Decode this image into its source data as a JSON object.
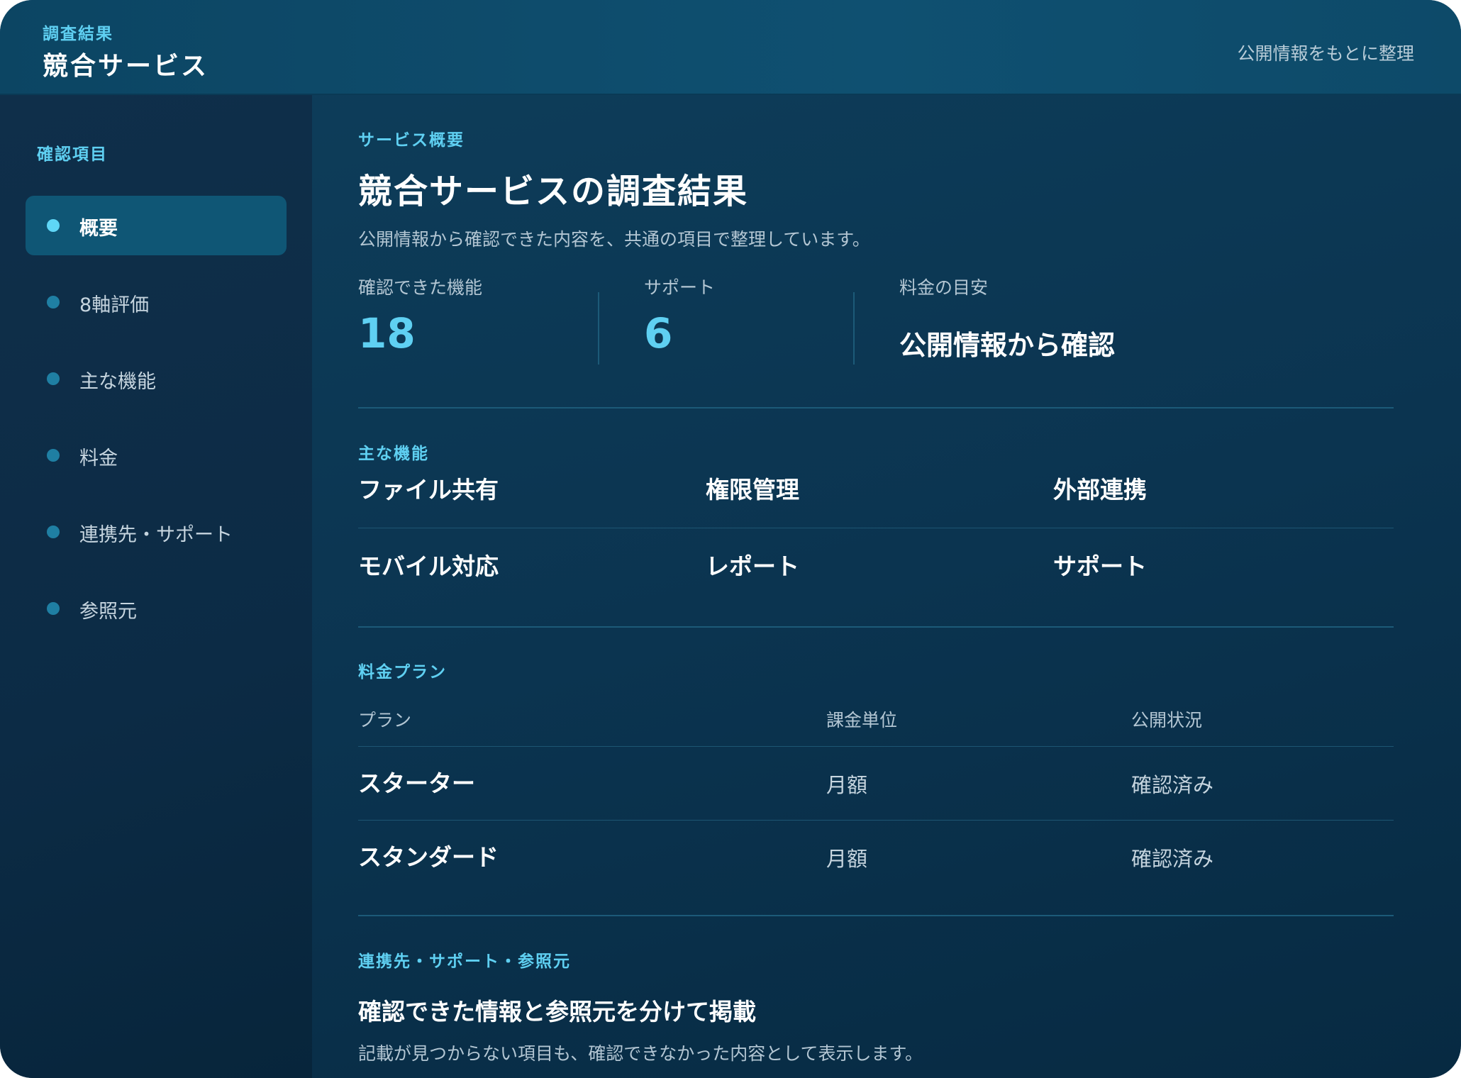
{
  "header": {
    "kicker": "調査結果",
    "title": "競合サービス",
    "note": "公開情報をもとに整理"
  },
  "sidebar": {
    "heading": "確認項目",
    "items": [
      {
        "label": "概要",
        "active": true
      },
      {
        "label": "8軸評価",
        "active": false
      },
      {
        "label": "主な機能",
        "active": false
      },
      {
        "label": "料金",
        "active": false
      },
      {
        "label": "連携先・サポート",
        "active": false
      },
      {
        "label": "参照元",
        "active": false
      }
    ]
  },
  "overview": {
    "kicker": "サービス概要",
    "title": "競合サービスの調査結果",
    "description": "公開情報から確認できた内容を、共通の項目で整理しています。",
    "stats": [
      {
        "label": "確認できた機能",
        "value": "18"
      },
      {
        "label": "サポート",
        "value": "6"
      },
      {
        "label": "料金の目安",
        "value": "公開情報から確認"
      }
    ]
  },
  "features": {
    "kicker": "主な機能",
    "items": [
      "ファイル共有",
      "権限管理",
      "外部連携",
      "モバイル対応",
      "レポート",
      "サポート"
    ]
  },
  "pricing": {
    "kicker": "料金プラン",
    "columns": [
      "プラン",
      "課金単位",
      "公開状況"
    ],
    "rows": [
      {
        "plan": "スターター",
        "unit": "月額",
        "status": "確認済み"
      },
      {
        "plan": "スタンダード",
        "unit": "月額",
        "status": "確認済み"
      }
    ]
  },
  "footer": {
    "kicker": "連携先・サポート・参照元",
    "title": "確認できた情報と参照元を分けて掲載",
    "description": "記載が見つからない項目も、確認できなかった内容として表示します。"
  }
}
